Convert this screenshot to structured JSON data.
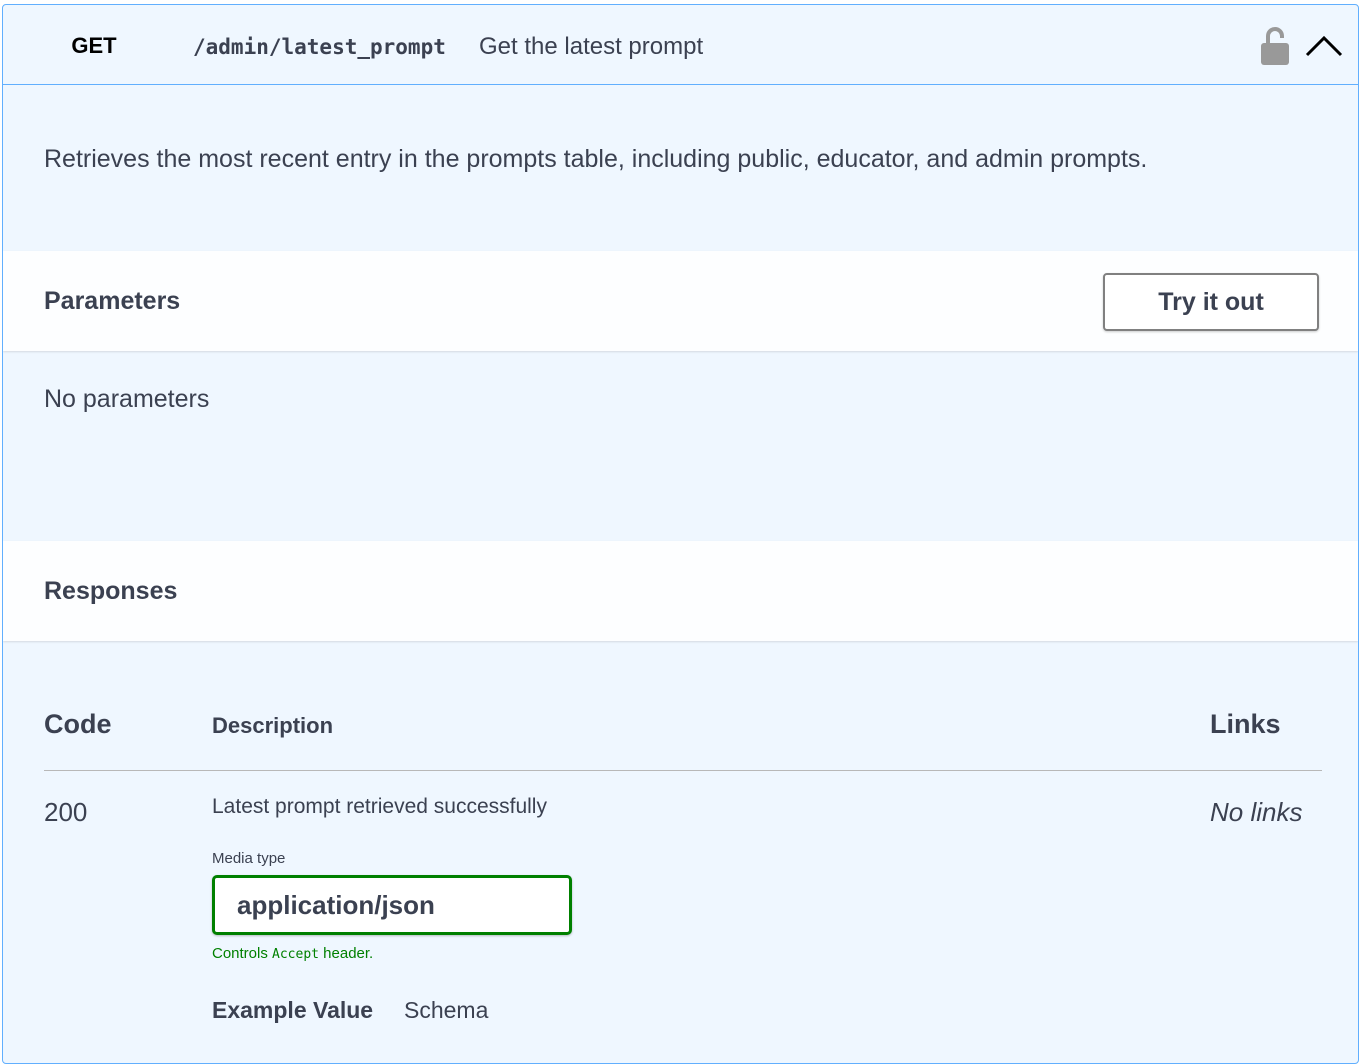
{
  "operation": {
    "method": "GET",
    "path": "/admin/latest_prompt",
    "summary": "Get the latest prompt",
    "description": "Retrieves the most recent entry in the prompts table, including public, educator, and admin prompts."
  },
  "parameters": {
    "title": "Parameters",
    "try_button": "Try it out",
    "empty_text": "No parameters"
  },
  "responses": {
    "title": "Responses",
    "columns": [
      "Code",
      "Description",
      "Links"
    ],
    "rows": [
      {
        "code": "200",
        "description": "Latest prompt retrieved successfully",
        "links": "No links",
        "media_type_label": "Media type",
        "media_type": "application/json",
        "controls_prefix": "Controls",
        "controls_code": "Accept",
        "controls_suffix": "header.",
        "tabs": [
          "Example Value",
          "Schema"
        ]
      }
    ]
  },
  "icons": {
    "lock": "unlocked-padlock-icon",
    "collapse": "chevron-up-icon"
  },
  "colors": {
    "method_accent": "#61affe",
    "media_border": "#008000",
    "text": "#3b4151"
  }
}
